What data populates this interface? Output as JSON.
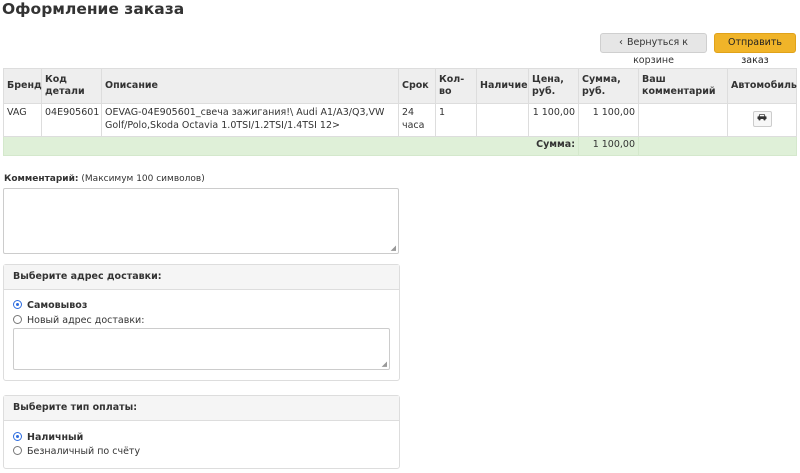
{
  "page": {
    "title": "Оформление заказа"
  },
  "toolbar": {
    "back_label": "Вернуться к корзине",
    "submit_label": "Отправить заказ"
  },
  "table": {
    "headers": [
      "Бренд",
      "Код детали",
      "Описание",
      "Срок",
      "Кол-во",
      "Наличие",
      "Цена, руб.",
      "Сумма, руб.",
      "Ваш комментарий",
      "Автомобиль"
    ],
    "rows": [
      {
        "brand": "VAG",
        "code": "04E905601",
        "description": "OEVAG-04E905601_свеча зажигания!\\ Audi A1/A3/Q3,VW Golf/Polo,Skoda Octavia 1.0TSI/1.2TSI/1.4TSI 12>",
        "term": "24 часа",
        "qty": "1",
        "availability": "",
        "price": "1 100,00",
        "sum": "1 100,00",
        "comment": ""
      }
    ],
    "total_label": "Сумма:",
    "total_value": "1 100,00"
  },
  "comment": {
    "label": "Комментарий:",
    "hint": "(Максимум 100 символов)",
    "value": ""
  },
  "delivery": {
    "title": "Выберите адрес доставки:",
    "options": [
      {
        "label": "Самовывоз",
        "checked": true
      },
      {
        "label": "Новый адрес доставки:",
        "checked": false
      }
    ],
    "address_value": ""
  },
  "payment": {
    "title": "Выберите тип оплаты:",
    "options": [
      {
        "label": "Наличный",
        "checked": true
      },
      {
        "label": "Безналичный по счёту",
        "checked": false
      }
    ]
  },
  "colors": {
    "accent_button": "#f0b429",
    "total_row": "#dff0d8",
    "radio_checked": "#2d6cdf"
  },
  "icons": {
    "back": "chevron-left-icon",
    "car": "car-icon"
  }
}
